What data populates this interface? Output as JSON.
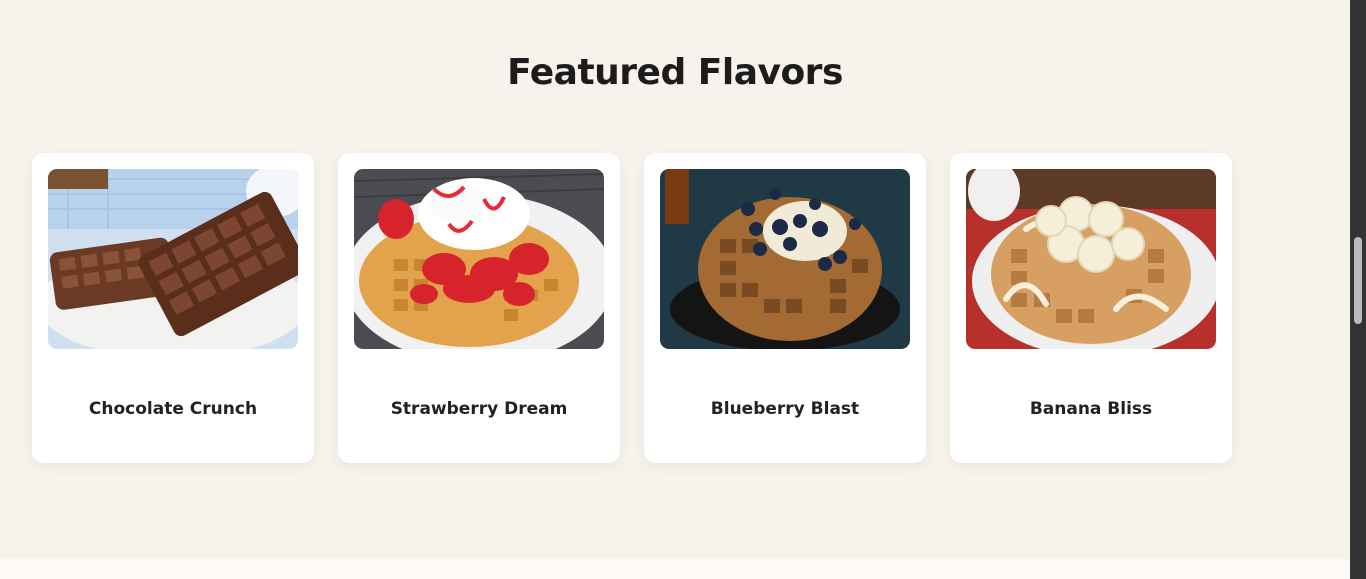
{
  "section": {
    "title": "Featured Flavors"
  },
  "flavors": [
    {
      "name": "Chocolate Crunch",
      "image": "chocolate-waffle-photo"
    },
    {
      "name": "Strawberry Dream",
      "image": "strawberry-waffle-photo"
    },
    {
      "name": "Blueberry Blast",
      "image": "blueberry-waffle-photo"
    },
    {
      "name": "Banana Bliss",
      "image": "banana-waffle-photo"
    }
  ],
  "colors": {
    "page_background": "#f7f2ec",
    "card_background": "#ffffff",
    "heading_text": "#1c1c1c",
    "next_section_background": "#fef9f5"
  }
}
